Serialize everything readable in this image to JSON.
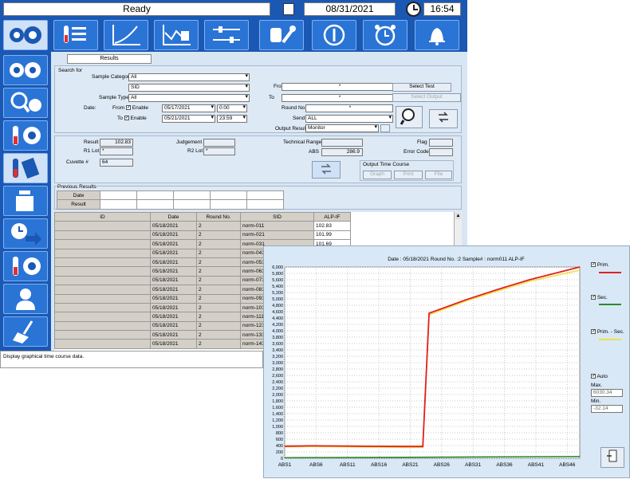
{
  "header": {
    "status": "Ready",
    "date": "08/31/2021",
    "time": "16:54"
  },
  "tab": {
    "label": "Results"
  },
  "search": {
    "title": "Search for",
    "sample_category_label": "Sample Category",
    "sample_category_value": "All",
    "sample_category_sub": "SID",
    "sample_type_label": "Sample Type",
    "sample_type_value": "All",
    "date_label": "Date:",
    "from_label": "From",
    "to_label": "To",
    "enable_label": "Enable",
    "from_date": "05/17/2021",
    "from_time": "0:00",
    "to_date": "05/21/2021",
    "to_time": "23:59",
    "from_field_label": "From",
    "from_field_value": "*",
    "to_field_label": "To",
    "to_field_value": "*",
    "round_label": "Round No.",
    "round_value": "*",
    "send_label": "Send",
    "send_value": "ALL",
    "output_result_label": "Output Result",
    "output_result_value": "Monitor",
    "select_test": "Select Test",
    "select_output": "Select Output"
  },
  "result": {
    "result_label": "Result",
    "result_value": "102.83",
    "r1lot_label": "R1 Lot",
    "r1lot_value": "*",
    "cuvette_label": "Cuvette #",
    "cuvette_value": "64",
    "judgement_label": "Judgement",
    "r2lot_label": "R2 Lot",
    "r2lot_value": "*",
    "technical_range_label": "Technical Range",
    "abs_label": "ABS",
    "abs_value": "286.9",
    "flag_label": "Flag",
    "error_code_label": "Error Code",
    "otc_title": "Output Time Course",
    "graph_btn": "Graph",
    "print_btn": "Print",
    "file_btn": "File"
  },
  "previous": {
    "title": "Previous Results",
    "date_label": "Date",
    "result_label": "Result"
  },
  "table": {
    "headers": [
      "ID",
      "Date",
      "Round No.",
      "SID",
      "ALP-IF"
    ],
    "rows": [
      [
        "",
        "05/18/2021",
        "2",
        "norm-011",
        "102.83"
      ],
      [
        "",
        "05/18/2021",
        "2",
        "norm-021",
        "101.99"
      ],
      [
        "",
        "05/18/2021",
        "2",
        "norm-031",
        "101.69"
      ],
      [
        "",
        "05/18/2021",
        "2",
        "norm-041",
        ""
      ],
      [
        "",
        "05/18/2021",
        "2",
        "norm-051",
        ""
      ],
      [
        "",
        "05/18/2021",
        "2",
        "norm-061",
        ""
      ],
      [
        "",
        "05/18/2021",
        "2",
        "norm-071",
        ""
      ],
      [
        "",
        "05/18/2021",
        "2",
        "norm-081",
        ""
      ],
      [
        "",
        "05/18/2021",
        "2",
        "norm-091",
        ""
      ],
      [
        "",
        "05/18/2021",
        "2",
        "norm-101",
        ""
      ],
      [
        "",
        "05/18/2021",
        "2",
        "norm-111",
        ""
      ],
      [
        "",
        "05/18/2021",
        "2",
        "norm-121",
        ""
      ],
      [
        "",
        "05/18/2021",
        "2",
        "norm-131",
        ""
      ],
      [
        "",
        "05/18/2021",
        "2",
        "norm-141",
        ""
      ]
    ]
  },
  "status_bar": {
    "message": "Display graphical time course data."
  },
  "chart_panel": {
    "prim_label": "Prim.",
    "sec_label": "Sec.",
    "prim_sec_label": "Prim. - Sec.",
    "auto_label": "Auto",
    "max_label": "Max.",
    "max_value": "6030.34",
    "min_label": "Min.",
    "min_value": "-32.14",
    "colors": {
      "prim": "#e02020",
      "sec": "#2a8a2a",
      "diff": "#f0e040"
    }
  },
  "chart_data": {
    "type": "line",
    "title": "Date : 05/18/2021  Round No. :2  Sample# : norm011  ALP-IF",
    "ylim": [
      0,
      6000
    ],
    "ytick_step": 200,
    "categories": [
      "ABS1",
      "ABS6",
      "ABS11",
      "ABS16",
      "ABS21",
      "ABS26",
      "ABS31",
      "ABS36",
      "ABS41",
      "ABS46"
    ],
    "x_count": 48,
    "series": [
      {
        "name": "Prim.",
        "color": "#e02020",
        "points": [
          [
            1,
            380
          ],
          [
            5,
            390
          ],
          [
            10,
            385
          ],
          [
            15,
            375
          ],
          [
            20,
            370
          ],
          [
            23,
            370
          ],
          [
            24,
            4550
          ],
          [
            30,
            4980
          ],
          [
            35,
            5300
          ],
          [
            40,
            5600
          ],
          [
            48,
            6000
          ]
        ]
      },
      {
        "name": "Sec.",
        "color": "#2a8a2a",
        "points": [
          [
            1,
            20
          ],
          [
            10,
            25
          ],
          [
            20,
            30
          ],
          [
            30,
            40
          ],
          [
            40,
            50
          ],
          [
            48,
            55
          ]
        ]
      },
      {
        "name": "Prim. - Sec.",
        "color": "#f0e040",
        "points": [
          [
            1,
            360
          ],
          [
            5,
            365
          ],
          [
            10,
            360
          ],
          [
            15,
            350
          ],
          [
            20,
            340
          ],
          [
            23,
            340
          ],
          [
            24,
            4500
          ],
          [
            30,
            4940
          ],
          [
            35,
            5250
          ],
          [
            40,
            5550
          ],
          [
            48,
            5900
          ]
        ]
      }
    ]
  }
}
